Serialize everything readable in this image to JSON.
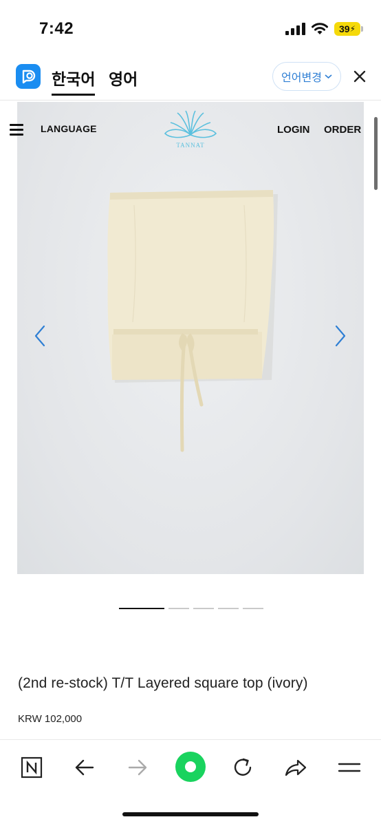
{
  "status": {
    "time": "7:42",
    "battery": "39"
  },
  "translator": {
    "source_lang": "한국어",
    "target_lang": "영어",
    "change_label": "언어변경"
  },
  "site": {
    "nav_language": "LANGUAGE",
    "nav_login": "LOGIN",
    "nav_order": "ORDER",
    "brand": "TANNAT"
  },
  "product": {
    "title": "(2nd re-stock) T/T Layered square top (ivory)",
    "price": "KRW 102,000",
    "slide_count": 5,
    "active_slide": 1
  },
  "colors": {
    "accent": "#1a8df1",
    "green": "#19d35e",
    "logo_blue": "#5bc0de",
    "arrow_blue": "#2f7fd4"
  },
  "icons": {
    "translator_logo": "papago-logo-icon",
    "close": "close-icon",
    "menu": "hamburger-menu-icon",
    "prev": "chevron-left-icon",
    "next": "chevron-right-icon"
  }
}
